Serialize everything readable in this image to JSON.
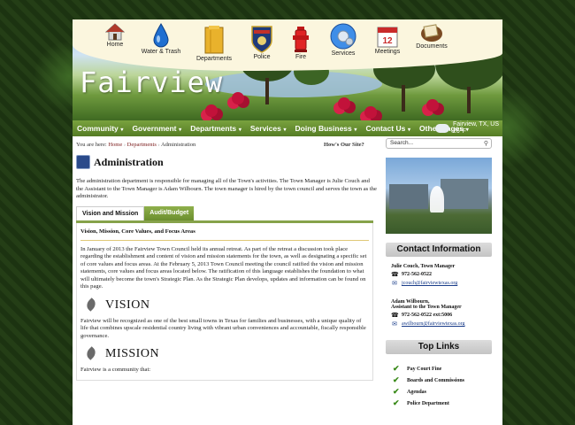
{
  "header": {
    "brand": "Fairview",
    "icons": [
      {
        "label": "Home",
        "icon": "house-icon"
      },
      {
        "label": "Water & Trash",
        "icon": "water-drop-icon"
      },
      {
        "label": "Departments",
        "icon": "folder-icon"
      },
      {
        "label": "Police",
        "icon": "police-badge-icon"
      },
      {
        "label": "Fire",
        "icon": "fire-hydrant-icon"
      },
      {
        "label": "Services",
        "icon": "gears-icon"
      },
      {
        "label": "Meetings",
        "icon": "calendar-icon"
      },
      {
        "label": "Documents",
        "icon": "documents-icon"
      }
    ],
    "calendar_day": "12"
  },
  "nav": {
    "items": [
      "Community",
      "Government",
      "Departments",
      "Services",
      "Doing Business",
      "Contact Us",
      "Other Pages"
    ],
    "weather": {
      "location": "Fairview, TX, US",
      "temp": "26°F"
    }
  },
  "breadcrumb": {
    "prefix": "You are here:",
    "home": "Home",
    "dept": "Departments",
    "current": "Administration"
  },
  "hows": "How's Our Site?",
  "page_title": "Administration",
  "intro": "The administration department is responsible for managing all of the Town's activities. The Town Manager is Julie Couch and the Assistant to the Town Manager is Adam Wilbourn. The town manager is hired by the town council and serves the town as the administrator.",
  "tabs": [
    "Vision and Mission",
    "Audit/Budget"
  ],
  "panel": {
    "subhead": "Vision, Mission, Core Values, and Focus Areas",
    "para1": "In January of 2013 the Fairview Town Council held its annual retreat. As part of the retreat a discussion took place regarding the establishment and content of vision and mission statements for the town, as well as designating a specific set of core values and focus areas. At the February 5, 2013 Town Council meeting the council ratified the vision and mission statements, core values and focus areas located below. The ratification of this language establishes the foundation to what will ultimately become the town's Strategic Plan. As the Strategic Plan develops, updates and information can be found on this page.",
    "vision_title": "VISION",
    "vision_text": "Fairview will be recognized as one of the best small towns in Texas for families and businesses, with a unique quality of life that combines upscale residential country living with vibrant urban conveniences and accountable, fiscally responsible governance.",
    "mission_title": "MISSION",
    "mission_text": "Fairview is a community that:"
  },
  "sidebar": {
    "search_placeholder": "Search...",
    "contact_head": "Contact Information",
    "contacts": [
      {
        "name": "Julie Couch, Town Manager",
        "role": "",
        "phone": "972-562-0522",
        "email": "jcouch@fairviewtexas.org"
      },
      {
        "name": "Adam Wilbourn,",
        "role": "Assistant to the Town Manager",
        "phone": "972-562-0522 ext:5006",
        "email": "awilbourn@fairviewtexas.org"
      }
    ],
    "links_head": "Top Links",
    "links": [
      "Pay Court Fine",
      "Boards and Commissions",
      "Agendas",
      "Police Department"
    ]
  },
  "colors": {
    "nav_green": "#6b8e2e",
    "accent_red": "#7a1a1a",
    "link_blue": "#1a3d8a"
  }
}
